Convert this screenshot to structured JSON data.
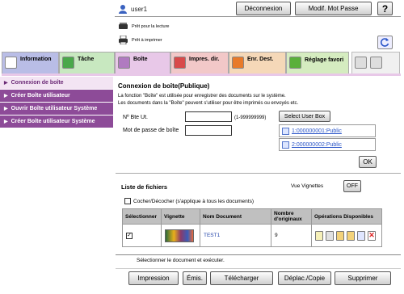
{
  "header": {
    "user_name": "user1",
    "logout_label": "Déconnexion",
    "change_password_label": "Modif. Mot Passe",
    "help_label": "?",
    "status_scan": "Prêt pour la lecture",
    "status_print": "Prêt à imprimer"
  },
  "tabs": [
    {
      "label": "Information"
    },
    {
      "label": "Tâche"
    },
    {
      "label": "Boîte",
      "active": true
    },
    {
      "label": "Impres. dir."
    },
    {
      "label": "Enr. Dest."
    },
    {
      "label": "Réglage favori"
    }
  ],
  "sidebar": {
    "items": [
      {
        "label": "Connexion de boîte",
        "active": true
      },
      {
        "label": "Créer Boîte utilisateur"
      },
      {
        "label": "Ouvrir Boîte utilisateur Système"
      },
      {
        "label": "Créer Boîte utilisateur Système"
      }
    ]
  },
  "main": {
    "title": "Connexion de boîte(Publique)",
    "desc_1": "La fonction \"Boîte\" est utilisée pour enregistrer des documents sur le système.",
    "desc_2": "Les documents dans la \"Boîte\" peuvent s'utiliser pour être imprimés ou envoyés etc.",
    "box_no_label": "Nº Bte Ut.",
    "box_no_value": "",
    "box_no_range": "(1-999999999)",
    "password_label": "Mot de passe de boîte",
    "password_value": "",
    "select_box_label": "Select User Box",
    "box_links": [
      "1:000000001:Public",
      "2:000000002:Public"
    ],
    "ok_label": "OK"
  },
  "file_list": {
    "title": "Liste de fichiers",
    "view_label": "Vue Vignettes",
    "view_toggle": "OFF",
    "check_all_label": "Cocher/Décocher (s'applique à tous les documents)",
    "check_all_checked": false,
    "columns": [
      "Sélectionner",
      "Vignette",
      "Nom Document",
      "Nombre d'originaux",
      "Opérations Disponibles"
    ],
    "rows": [
      {
        "selected": true,
        "name": "TEST1",
        "originals": "9"
      }
    ],
    "exec_hint": "Sélectionner le document et exécuter."
  },
  "actions": {
    "print": "Impression",
    "send": "Émis.",
    "download": "Télécharger",
    "move_copy": "Déplac./Copie",
    "delete": "Supprimer"
  },
  "colors": {
    "accent": "#8d4b98",
    "tab_info": "#b9bde6",
    "tab_job": "#c8e8c0",
    "tab_box": "#e8c8e8",
    "tab_direct": "#f2c8c8",
    "tab_dest": "#f5d8b8",
    "tab_fav": "#d5ecc0",
    "link": "#2a55c8"
  }
}
